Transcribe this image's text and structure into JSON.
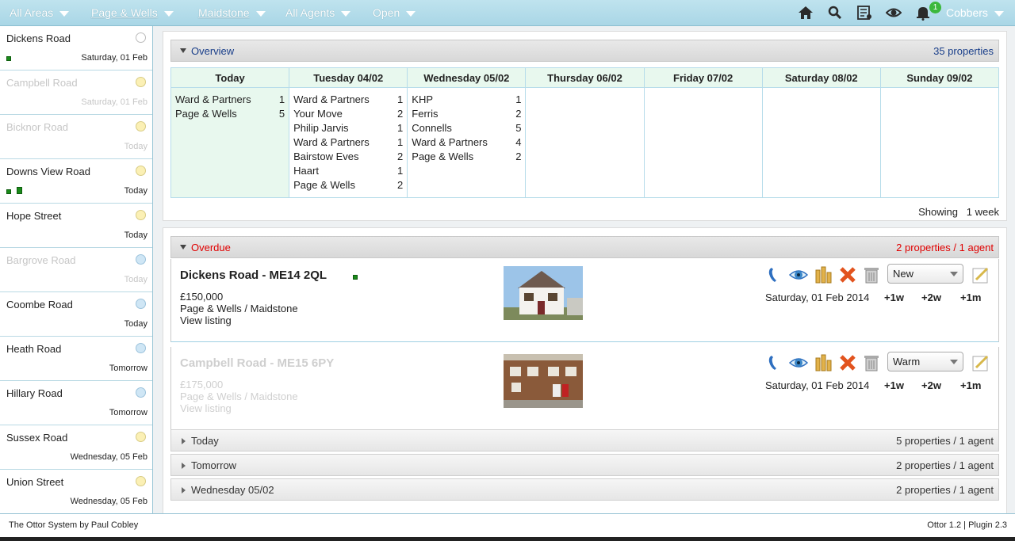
{
  "filters": [
    {
      "label": "All Areas"
    },
    {
      "label": "Page & Wells"
    },
    {
      "label": "Maidstone"
    },
    {
      "label": "All Agents"
    },
    {
      "label": "Open"
    }
  ],
  "topbar": {
    "icons": [
      "home-icon",
      "search-icon",
      "list-icon",
      "eye-icon",
      "bell-icon"
    ],
    "notification_count": "1",
    "user": "Cobbers"
  },
  "sidebar": {
    "items": [
      {
        "name": "Dickens Road",
        "date": "Saturday, 01 Feb",
        "status": "white",
        "faded": false
      },
      {
        "name": "Campbell Road",
        "date": "Saturday, 01 Feb",
        "status": "yellow",
        "faded": true
      },
      {
        "name": "Bicknor Road",
        "date": "Today",
        "status": "yellow",
        "faded": true
      },
      {
        "name": "Downs View Road",
        "date": "Today",
        "status": "yellow",
        "faded": false
      },
      {
        "name": "Hope Street",
        "date": "Today",
        "status": "yellow",
        "faded": false
      },
      {
        "name": "Bargrove Road",
        "date": "Today",
        "status": "blue",
        "faded": true
      },
      {
        "name": "Coombe Road",
        "date": "Today",
        "status": "blue",
        "faded": false
      },
      {
        "name": "Heath Road",
        "date": "Tomorrow",
        "status": "blue",
        "faded": false
      },
      {
        "name": "Hillary Road",
        "date": "Tomorrow",
        "status": "blue",
        "faded": false
      },
      {
        "name": "Sussex Road",
        "date": "Wednesday, 05 Feb",
        "status": "yellow",
        "faded": false
      },
      {
        "name": "Union Street",
        "date": "Wednesday, 05 Feb",
        "status": "yellow",
        "faded": false
      }
    ]
  },
  "overview": {
    "title": "Overview",
    "count": "35 properties",
    "days": [
      "Today",
      "Tuesday 04/02",
      "Wednesday 05/02",
      "Thursday 06/02",
      "Friday 07/02",
      "Saturday 08/02",
      "Sunday 09/02"
    ],
    "columns": [
      [
        {
          "agent": "Ward & Partners",
          "n": "1"
        },
        {
          "agent": "Page & Wells",
          "n": "5"
        }
      ],
      [
        {
          "agent": "Ward & Partners",
          "n": "1"
        },
        {
          "agent": "Your Move",
          "n": "2"
        },
        {
          "agent": "Philip Jarvis",
          "n": "1"
        },
        {
          "agent": "Ward & Partners",
          "n": "1"
        },
        {
          "agent": "Bairstow Eves",
          "n": "2"
        },
        {
          "agent": "Haart",
          "n": "1"
        },
        {
          "agent": "Page & Wells",
          "n": "2"
        }
      ],
      [
        {
          "agent": "KHP",
          "n": "1"
        },
        {
          "agent": "Ferris",
          "n": "2"
        },
        {
          "agent": "Connells",
          "n": "5"
        },
        {
          "agent": "Ward & Partners",
          "n": "4"
        },
        {
          "agent": "Page & Wells",
          "n": "2"
        }
      ],
      [],
      [],
      [],
      []
    ],
    "showing_label": "Showing",
    "showing_value": "1 week"
  },
  "overdue": {
    "title": "Overdue",
    "meta": "2 properties / 1 agent",
    "properties": [
      {
        "title": "Dickens Road - ME14 2QL",
        "price": "£150,000",
        "agent": "Page & Wells / Maidstone",
        "link": "View listing",
        "status": "New",
        "date": "Saturday, 01 Feb 2014",
        "faded": false
      },
      {
        "title": "Campbell Road - ME15 6PY",
        "price": "£175,000",
        "agent": "Page & Wells / Maidstone",
        "link": "View listing",
        "status": "Warm",
        "date": "Saturday, 01 Feb 2014",
        "faded": true
      }
    ],
    "snooze": [
      "+1w",
      "+2w",
      "+1m"
    ],
    "action_icons": [
      "phone-icon",
      "eye-icon",
      "coins-icon",
      "cross-icon",
      "trash-icon",
      "note-icon"
    ]
  },
  "groups": [
    {
      "title": "Today",
      "meta": "5 properties / 1 agent"
    },
    {
      "title": "Tomorrow",
      "meta": "2 properties / 1 agent"
    },
    {
      "title": "Wednesday 05/02",
      "meta": "2 properties / 1 agent"
    }
  ],
  "footer": {
    "left": "The Ottor System by Paul Cobley",
    "right": "Ottor 1.2 | Plugin 2.3"
  },
  "colors": {
    "topbar": "#a9d6e6",
    "overdue_red": "#e00000",
    "overview_blue": "#1a3f8a",
    "today_green": "#e8f8ee",
    "status_green": "#1a8a1a"
  }
}
